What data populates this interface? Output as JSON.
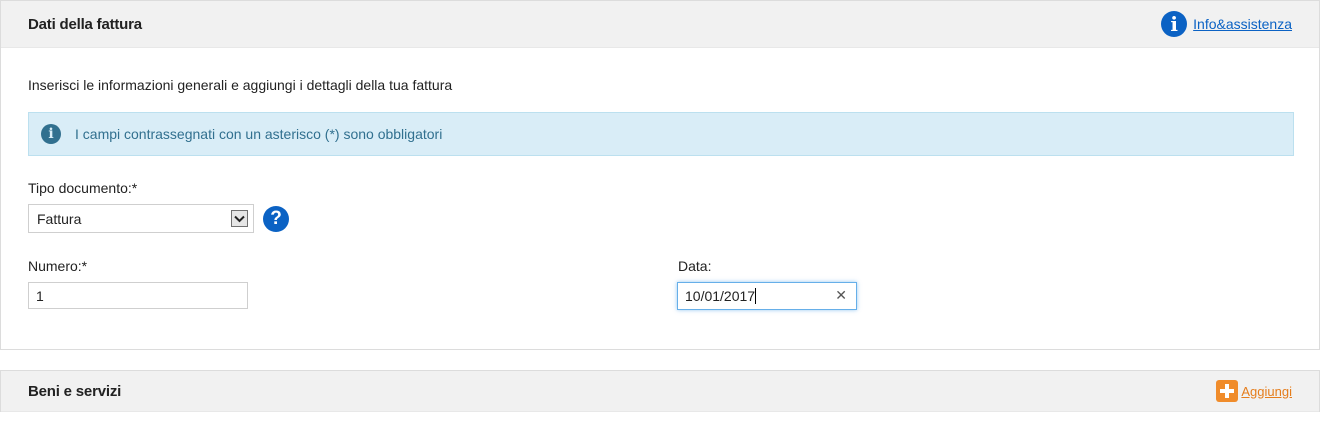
{
  "section1": {
    "title": "Dati della fattura",
    "help_link": "Info&assistenza",
    "intro": "Inserisci le informazioni generali e aggiungi i dettagli della tua fattura",
    "alert": "I campi contrassegnati con un asterisco (*) sono obbligatori",
    "tipo_documento": {
      "label": "Tipo documento:*",
      "value": "Fattura"
    },
    "numero": {
      "label": "Numero:*",
      "value": "1"
    },
    "data": {
      "label": "Data:",
      "value": "10/01/2017"
    }
  },
  "section2": {
    "title": "Beni e servizi",
    "add_link": "Aggiungi"
  },
  "colors": {
    "link": "#0b62c4",
    "alert_bg": "#d9edf7",
    "accent_orange": "#f08c2b"
  },
  "icons": [
    "info-icon",
    "question-icon",
    "clear-icon",
    "plus-icon",
    "chevron-down-icon"
  ]
}
